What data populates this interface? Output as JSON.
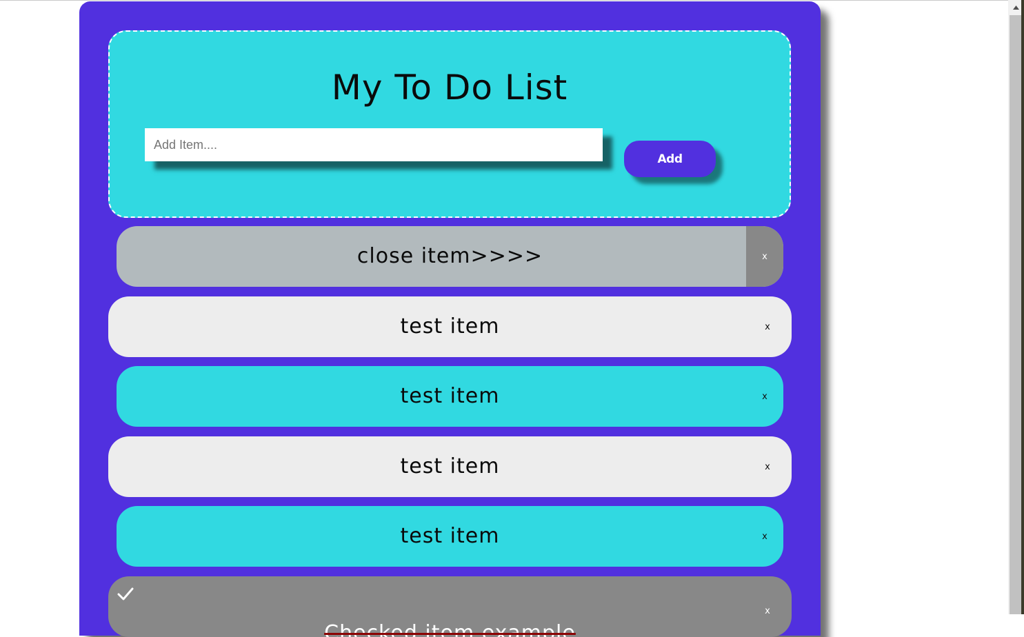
{
  "header": {
    "title": "My To Do List",
    "input_placeholder": "Add Item....",
    "add_label": "Add"
  },
  "items": [
    {
      "text": "close item>>>>",
      "close": "x"
    },
    {
      "text": "test item",
      "close": "x"
    },
    {
      "text": "test item",
      "close": "x"
    },
    {
      "text": "test item",
      "close": "x"
    },
    {
      "text": "test item",
      "close": "x"
    },
    {
      "text": "Checked item example",
      "close": "x",
      "checked": true
    }
  ],
  "colors": {
    "background": "#5130df",
    "header": "#31d9e1",
    "item_light": "#ededed",
    "item_accent": "#31d9e1",
    "item_hover": "#b2babd",
    "item_checked": "#888888",
    "strike": "#8b0000"
  }
}
